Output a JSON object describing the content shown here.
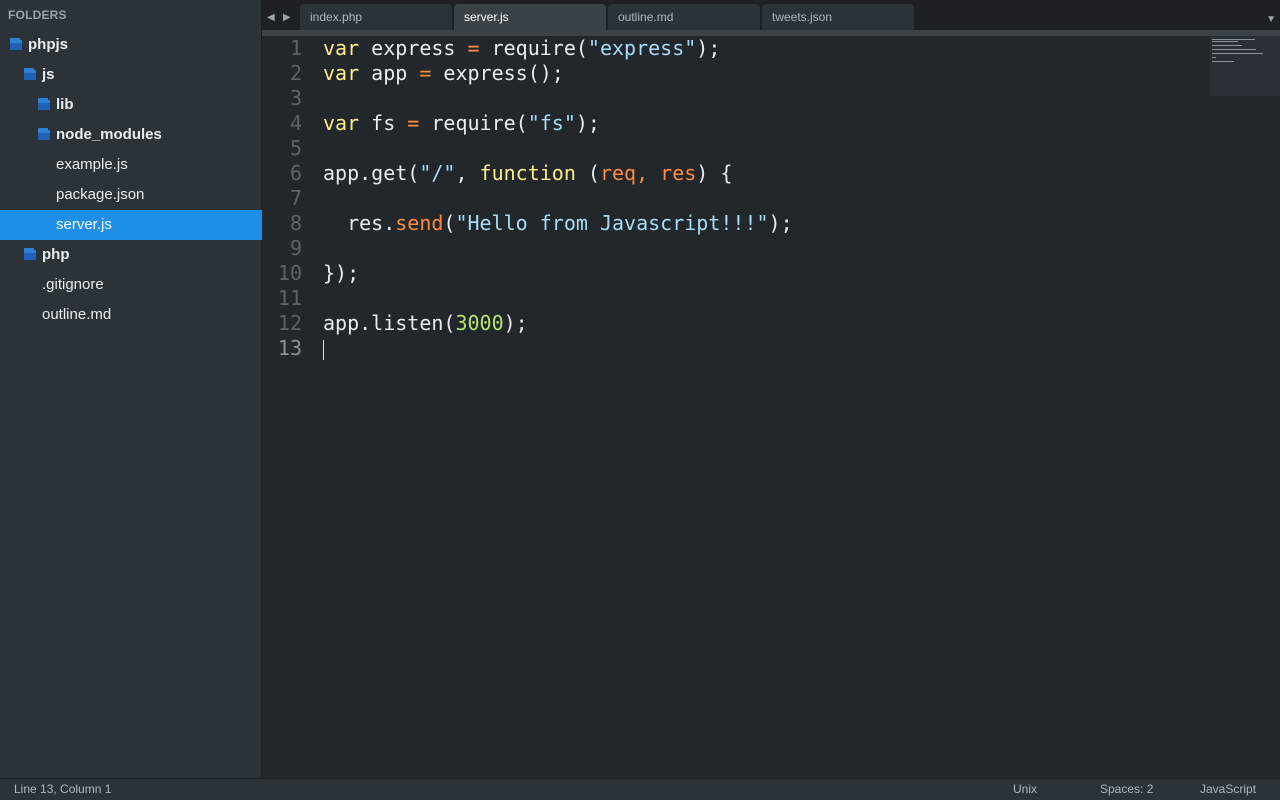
{
  "sidebar": {
    "title": "FOLDERS",
    "items": [
      {
        "label": "phpjs",
        "type": "folder",
        "depth": 0
      },
      {
        "label": "js",
        "type": "folder",
        "depth": 1
      },
      {
        "label": "lib",
        "type": "folder",
        "depth": 2
      },
      {
        "label": "node_modules",
        "type": "folder",
        "depth": 2
      },
      {
        "label": "example.js",
        "type": "file",
        "depth": 2
      },
      {
        "label": "package.json",
        "type": "file",
        "depth": 2
      },
      {
        "label": "server.js",
        "type": "file",
        "depth": 2,
        "selected": true
      },
      {
        "label": "php",
        "type": "folder",
        "depth": 1
      },
      {
        "label": ".gitignore",
        "type": "file",
        "depth": 1
      },
      {
        "label": "outline.md",
        "type": "file",
        "depth": 1
      }
    ]
  },
  "tabs": {
    "back_icon": "triangle-left-icon",
    "forward_icon": "triangle-right-icon",
    "items": [
      {
        "label": "index.php",
        "active": false
      },
      {
        "label": "server.js",
        "active": true
      },
      {
        "label": "outline.md",
        "active": false
      },
      {
        "label": "tweets.json",
        "active": false
      }
    ],
    "dropdown_icon": "triangle-down-icon"
  },
  "editor": {
    "current_line": 13,
    "lines": [
      [
        {
          "t": "var",
          "c": "kw"
        },
        {
          "t": " express "
        },
        {
          "t": "=",
          "c": "op"
        },
        {
          "t": " require("
        },
        {
          "t": "\"express\"",
          "c": "str"
        },
        {
          "t": ");"
        }
      ],
      [
        {
          "t": "var",
          "c": "kw"
        },
        {
          "t": " app "
        },
        {
          "t": "=",
          "c": "op"
        },
        {
          "t": " express();"
        }
      ],
      [],
      [
        {
          "t": "var",
          "c": "kw"
        },
        {
          "t": " fs "
        },
        {
          "t": "=",
          "c": "op"
        },
        {
          "t": " require("
        },
        {
          "t": "\"fs\"",
          "c": "str"
        },
        {
          "t": ");"
        }
      ],
      [],
      [
        {
          "t": "app.get("
        },
        {
          "t": "\"/\"",
          "c": "str"
        },
        {
          "t": ", "
        },
        {
          "t": "function",
          "c": "fn"
        },
        {
          "t": " ("
        },
        {
          "t": "req, res",
          "c": "param"
        },
        {
          "t": ") {"
        }
      ],
      [],
      [
        {
          "t": "  res."
        },
        {
          "t": "send",
          "c": "method"
        },
        {
          "t": "("
        },
        {
          "t": "\"Hello from Javascript!!!\"",
          "c": "str"
        },
        {
          "t": ");"
        }
      ],
      [],
      [
        {
          "t": "});"
        }
      ],
      [],
      [
        {
          "t": "app.listen("
        },
        {
          "t": "3000",
          "c": "num"
        },
        {
          "t": ");"
        }
      ],
      []
    ]
  },
  "status": {
    "position": "Line 13, Column 1",
    "line_endings": "Unix",
    "indentation": "Spaces: 2",
    "syntax": "JavaScript"
  },
  "colors": {
    "selection": "#1e8fe6",
    "folder_icon": "#2f7fd6",
    "keyword": "#ffec8a",
    "operator": "#ff8b3d",
    "string": "#a6dcf5",
    "number": "#b6e26d"
  }
}
